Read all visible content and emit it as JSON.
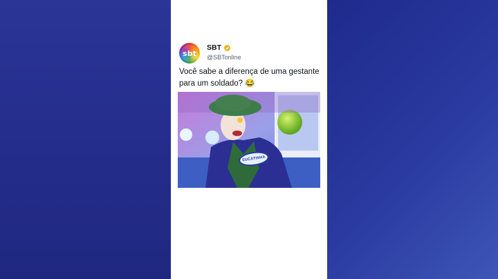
{
  "tweet": {
    "avatar_text": "sbt",
    "display_name": "SBT",
    "handle": "@SBTonline",
    "text": "Você sabe a diferença de uma gestante para um soldado? 😂",
    "photo_nametag": "SUCATINHA"
  },
  "colors": {
    "background": "#26308f",
    "card": "#ffffff",
    "verified_badge": "#e2b719",
    "text_primary": "#0f1419",
    "text_secondary": "#536471"
  }
}
